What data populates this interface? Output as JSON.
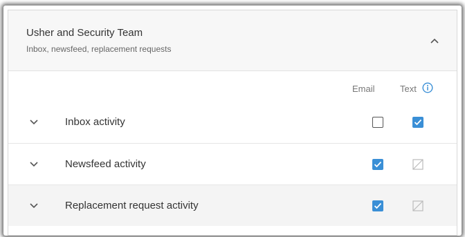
{
  "card": {
    "title": "Usher and Security Team",
    "subtitle": "Inbox, newsfeed, replacement requests"
  },
  "columns": {
    "email": "Email",
    "text": "Text"
  },
  "rows": [
    {
      "label": "Inbox activity",
      "email": "unchecked",
      "text": "checked"
    },
    {
      "label": "Newsfeed activity",
      "email": "checked",
      "text": "disabled"
    },
    {
      "label": "Replacement request activity",
      "email": "checked",
      "text": "disabled"
    }
  ],
  "colors": {
    "accent": "#3a8fd6",
    "header_bg": "#f7f7f7",
    "shaded_row": "#f4f4f4"
  },
  "icons": {
    "collapse": "chevron-up-icon",
    "expand": "chevron-down-icon",
    "info": "info-icon",
    "disabled_checkbox": "checkbox-disabled-icon"
  }
}
